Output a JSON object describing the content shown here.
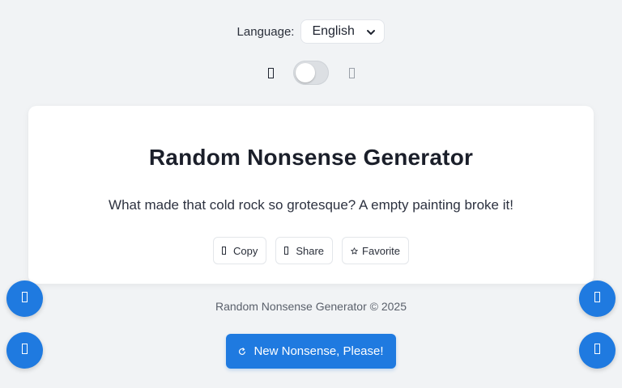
{
  "language": {
    "label": "Language:",
    "selected": "English"
  },
  "theme": {
    "light_icon": "sun-icon",
    "dark_icon": "moon-icon",
    "dark_mode": false
  },
  "card": {
    "title": "Random Nonsense Generator",
    "sentence": "What made that cold rock so grotesque? A empty painting broke it!",
    "actions": [
      {
        "label": "Copy",
        "icon": "copy-icon"
      },
      {
        "label": "Share",
        "icon": "share-icon"
      },
      {
        "label": "Favorite",
        "icon": "star-icon"
      }
    ]
  },
  "footer": {
    "text": "Random Nonsense Generator © 2025"
  },
  "generate_button": {
    "label": "New Nonsense, Please!",
    "icon": "refresh-icon"
  },
  "floating_buttons": [
    {
      "icon": "floating-left-top-icon"
    },
    {
      "icon": "floating-left-bottom-icon"
    },
    {
      "icon": "floating-right-top-icon"
    },
    {
      "icon": "floating-right-bottom-icon"
    }
  ],
  "colors": {
    "accent": "#1f7ae0",
    "background": "#f1f3f5",
    "card": "#ffffff",
    "toggle_track": "#dcdfe3"
  }
}
